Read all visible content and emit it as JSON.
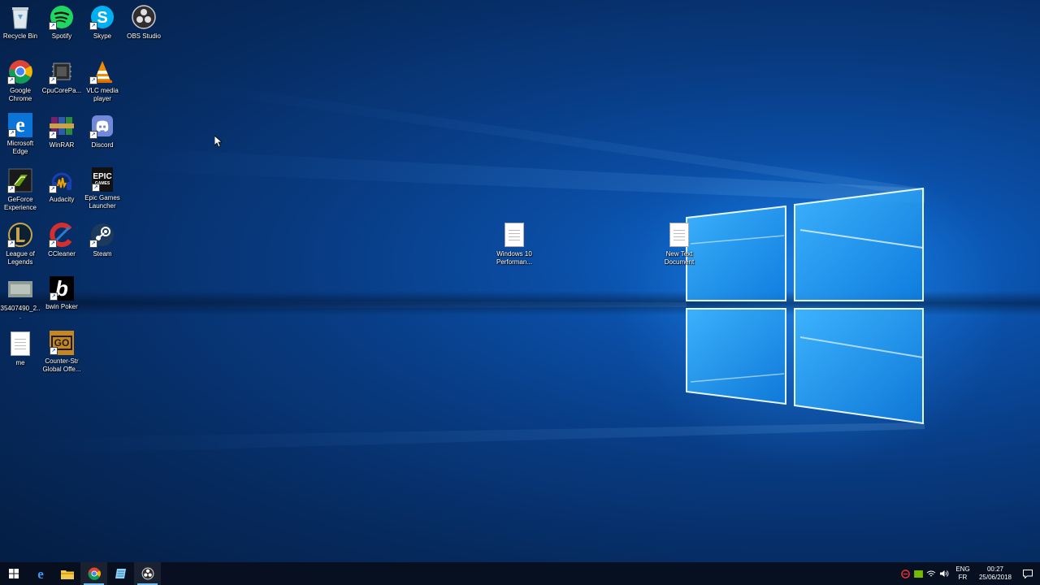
{
  "desktop": {
    "icons": [
      {
        "name": "recycle-bin",
        "label": "Recycle Bin"
      },
      {
        "name": "spotify",
        "label": "Spotify"
      },
      {
        "name": "skype",
        "label": "Skype"
      },
      {
        "name": "obs-studio",
        "label": "OBS Studio"
      },
      {
        "name": "google-chrome",
        "label": "Google Chrome"
      },
      {
        "name": "cpucorepa",
        "label": "CpuCorePa..."
      },
      {
        "name": "vlc",
        "label": "VLC media player"
      },
      {
        "name": "microsoft-edge",
        "label": "Microsoft Edge"
      },
      {
        "name": "winrar",
        "label": "WinRAR"
      },
      {
        "name": "discord",
        "label": "Discord"
      },
      {
        "name": "geforce-experience",
        "label": "GeForce Experience"
      },
      {
        "name": "audacity",
        "label": "Audacity"
      },
      {
        "name": "epic-games",
        "label": "Epic Games Launcher"
      },
      {
        "name": "league-of-legends",
        "label": "League of Legends"
      },
      {
        "name": "ccleaner",
        "label": "CCleaner"
      },
      {
        "name": "steam",
        "label": "Steam"
      },
      {
        "name": "image-file",
        "label": "35407490_2..."
      },
      {
        "name": "bwin-poker",
        "label": "bwin Poker"
      },
      {
        "name": "me-file",
        "label": "me"
      },
      {
        "name": "counter-strike",
        "label": "Counter-Str Global Offe..."
      },
      {
        "name": "windows10-perf",
        "label": "Windows 10 Performan..."
      },
      {
        "name": "new-text-document",
        "label": "New Text Document"
      }
    ],
    "epic_logo_text": "EPIC",
    "epic_logo_sub": "GAMES",
    "csgo_badge": "GO",
    "bwin_letter": "b",
    "edge_letter": "e"
  },
  "taskbar": {
    "lang_top": "ENG",
    "lang_bottom": "FR",
    "time": "00:27",
    "date": "25/06/2018"
  },
  "colors": {
    "accent": "#76b9ed",
    "taskbar_bg": "#080e1c"
  }
}
